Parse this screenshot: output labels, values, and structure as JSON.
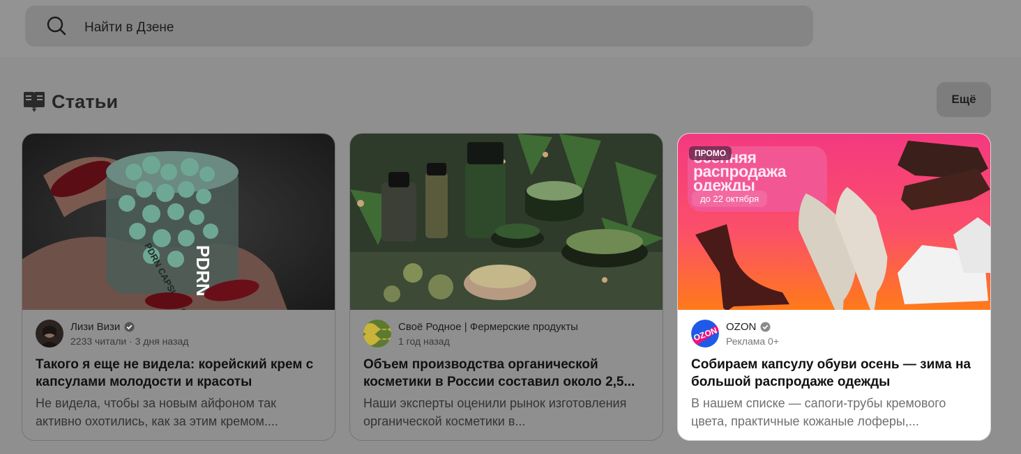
{
  "search": {
    "placeholder": "Найти в Дзене"
  },
  "section": {
    "title": "Статьи",
    "more_label": "Ещё"
  },
  "cards": [
    {
      "author": "Лизи Визи",
      "sub": "2233 читали · 3 дня назад",
      "title": "Такого я еще не видела: корейский крем с капсулами молодости и красоты",
      "desc": "Не видела, чтобы за новым айфоном так активно охотились, как за этим кремом....",
      "image_label": "PDRN CAPSULE CREAM"
    },
    {
      "author": "Своё Родное | Фермерские продукты",
      "sub": "1 год назад",
      "title": "Объем производства органической косметики в России составил около 2,5...",
      "desc": "Наши эксперты оценили рынок изготовления органической косметики в..."
    },
    {
      "author": "OZON",
      "sub": "Реклама 0+",
      "title": "Собираем капсулу обуви осень — зима на большой распродаже одежды",
      "desc": "В нашем списке — сапоги-трубы кремового цвета, практичные кожаные лоферы,...",
      "promo_badge": "ПРОМО",
      "promo_headline": "осенняя распродажа одежды",
      "promo_date": "до 22 октября",
      "avatar_text": "OZON"
    }
  ],
  "colors": {
    "promo_pink": "#f4397f",
    "promo_orange": "#ff7a1a",
    "ozon_blue": "#2059e8"
  }
}
